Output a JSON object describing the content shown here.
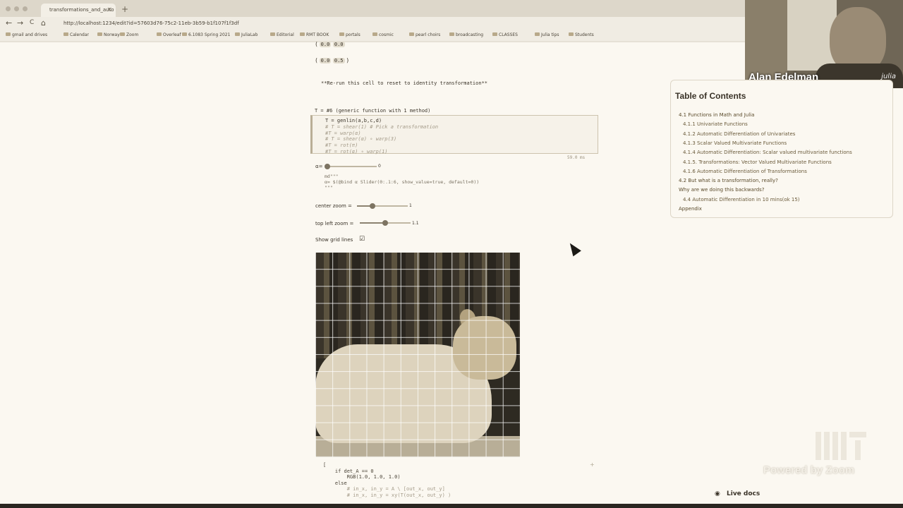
{
  "browser": {
    "tab_title": "transformations_and_auto",
    "tab_close": "×",
    "new_tab": "+",
    "url": "http://localhost:1234/edit?id=57603d76-75c2-11eb-3b59-b1f107f1f3df",
    "back": "←",
    "forward": "→",
    "reload": "C",
    "home": "⌂",
    "bookmarks": [
      "gmail and drives",
      "Calendar",
      "Norway",
      "Zoom",
      "Overleaf",
      "6.1083 Spring 2021",
      "JuliaLab",
      "Editorial",
      "RMT BOOK",
      "portals",
      "cosmic",
      "pearl choirs",
      "broadcasting",
      "CLASSES",
      "Julia tips",
      "Students"
    ]
  },
  "video": {
    "name": "Alan Edelman",
    "logo": "julia"
  },
  "notebook": {
    "pill_row1": [
      "0.0",
      "0.0"
    ],
    "pill_row2": [
      "0.0",
      "0.5"
    ],
    "bracket_open": "(",
    "bracket_close": ")",
    "rerun_text": "**Re-run this cell to reset to identity transformation**",
    "cell_output": "T = #6 (generic function with 1 method)",
    "code_lines": [
      "T = genlin(a,b,c,d)",
      "# T = shear(1) # Pick a transformation",
      "#T = warp(α)",
      "# T = shear(α) ∘ warp(3)",
      "#T = rot(π)",
      "#T = rot(α) ∘ warp(1)"
    ],
    "timing": "59.0 ms",
    "alpha_label": "α=",
    "alpha_value": "0",
    "md_lines": [
      "md\"\"\"",
      "α= $(@bind α Slider(0:.1:6, show_value=true, default=0))",
      "\"\"\""
    ],
    "center_zoom_label": "center zoom =",
    "center_zoom_value": "1",
    "center_zoom_fraction": 0.3,
    "top_left_zoom_label": "top left zoom =",
    "top_left_zoom_value": "1.1",
    "top_left_zoom_fraction": 0.5,
    "show_grid_label": "Show grid lines",
    "show_grid_checked": "☑",
    "bottom_code_lines": [
      "[",
      "    if det_A == 0",
      "        RGB(1.0, 1.0, 1.0)",
      "    else",
      "",
      "        # in_x, in_y = A \\ [out_x, out_y]",
      "        # in_x, in_y = xy(T(out_x, out_y) )"
    ],
    "add_cell": "+"
  },
  "toc": {
    "title": "Table of Contents",
    "items": [
      {
        "label": "4.1 Functions in Math and Julia",
        "level": 1
      },
      {
        "label": "4.1.1 Univariate Functions",
        "level": 2
      },
      {
        "label": "4.1.2 Automatic Differentiation of Univariates",
        "level": 2
      },
      {
        "label": "4.1.3 Scalar Valued Multivariate Functions",
        "level": 2
      },
      {
        "label": "4.1.4 Automatic Differentiation: Scalar valued multivariate functions",
        "level": 2
      },
      {
        "label": "4.1.5. Transformations: Vector Valued Multivariate Functions",
        "level": 2
      },
      {
        "label": "4.1.6 Automatic Differentiation of Transformations",
        "level": 2
      },
      {
        "label": "4.2 But what is a transformation, really?",
        "level": 1
      },
      {
        "label": "Why are we doing this backwards?",
        "level": 1
      },
      {
        "label": "4.4 Automatic Differentiation in 10 mins(ok 15)",
        "level": 2
      },
      {
        "label": "Appendix",
        "level": 1
      }
    ]
  },
  "overlay": {
    "zoom_watermark": "Powered by Zoom",
    "live_docs": "Live docs",
    "live_docs_icon": "◉"
  },
  "colors": {
    "accent": "#7d7462",
    "background": "#fbf8f1"
  }
}
